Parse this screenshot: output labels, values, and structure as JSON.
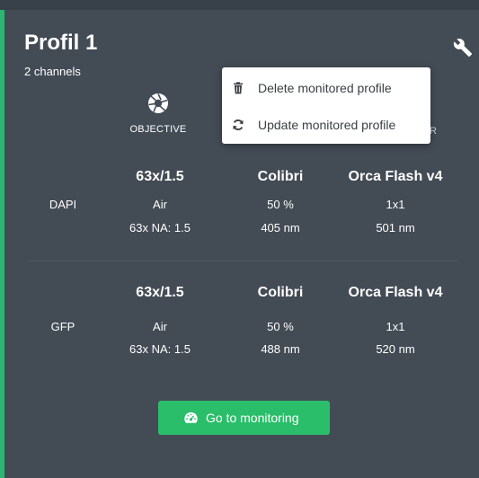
{
  "profile": {
    "title": "Profil 1",
    "subtitle": "2 channels"
  },
  "columns": {
    "objective": "OBJECTIVE",
    "obscured_tail": "R"
  },
  "menu": {
    "items": [
      {
        "label": "Delete monitored profile",
        "icon": "trash-icon"
      },
      {
        "label": "Update monitored profile",
        "icon": "refresh-icon"
      }
    ]
  },
  "channels": [
    {
      "label": "DAPI",
      "objective": {
        "name": "63x/1.5",
        "medium": "Air",
        "na": "63x NA: 1.5"
      },
      "illumination": {
        "name": "Colibri",
        "power": "50 %",
        "wavelength": "405  nm"
      },
      "detector": {
        "name": "Orca Flash v4",
        "binning": "1x1",
        "wavelength": "501 nm"
      }
    },
    {
      "label": "GFP",
      "objective": {
        "name": "63x/1.5",
        "medium": "Air",
        "na": "63x NA: 1.5"
      },
      "illumination": {
        "name": "Colibri",
        "power": "50 %",
        "wavelength": "488  nm"
      },
      "detector": {
        "name": "Orca Flash v4",
        "binning": "1x1",
        "wavelength": "520 nm"
      }
    }
  ],
  "actions": {
    "go_to_monitoring": "Go to monitoring"
  },
  "colors": {
    "card_bg": "#434b55",
    "accent_border": "#2bb673",
    "button_green": "#2bbe6a",
    "menu_bg": "#ffffff"
  }
}
